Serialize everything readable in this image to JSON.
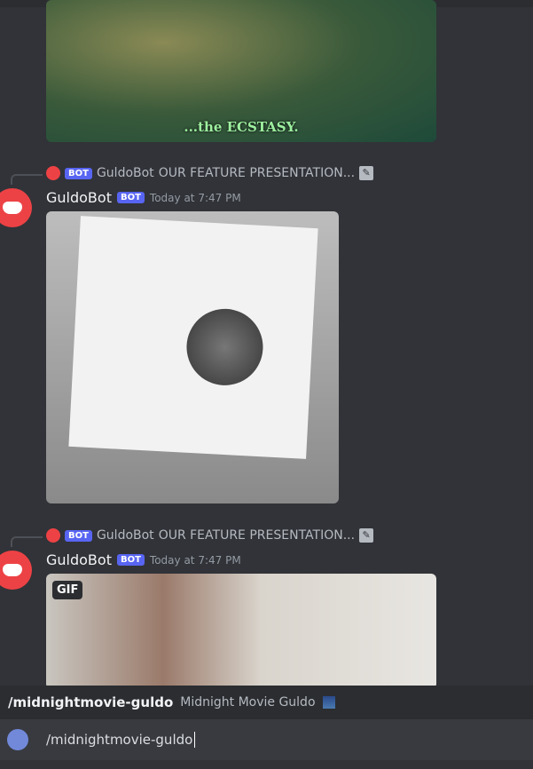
{
  "messages": [
    {
      "image_caption": "...the ECSTASY."
    },
    {
      "reply": {
        "author": "GuldoBot",
        "badge": "BOT",
        "text": "OUR FEATURE PRESENTATION..."
      },
      "author": "GuldoBot",
      "badge": "BOT",
      "timestamp": "Today at 7:47 PM"
    },
    {
      "reply": {
        "author": "GuldoBot",
        "badge": "BOT",
        "text": "OUR FEATURE PRESENTATION..."
      },
      "author": "GuldoBot",
      "badge": "BOT",
      "timestamp": "Today at 7:47 PM",
      "media_badge": "GIF"
    }
  ],
  "autocomplete": {
    "command": "/midnightmovie-guldo",
    "description": "Midnight Movie Guldo"
  },
  "composer": {
    "value": "/midnightmovie-guldo"
  },
  "colors": {
    "background": "#313338",
    "bot_badge": "#5865f2",
    "avatar": "#ed4245"
  }
}
